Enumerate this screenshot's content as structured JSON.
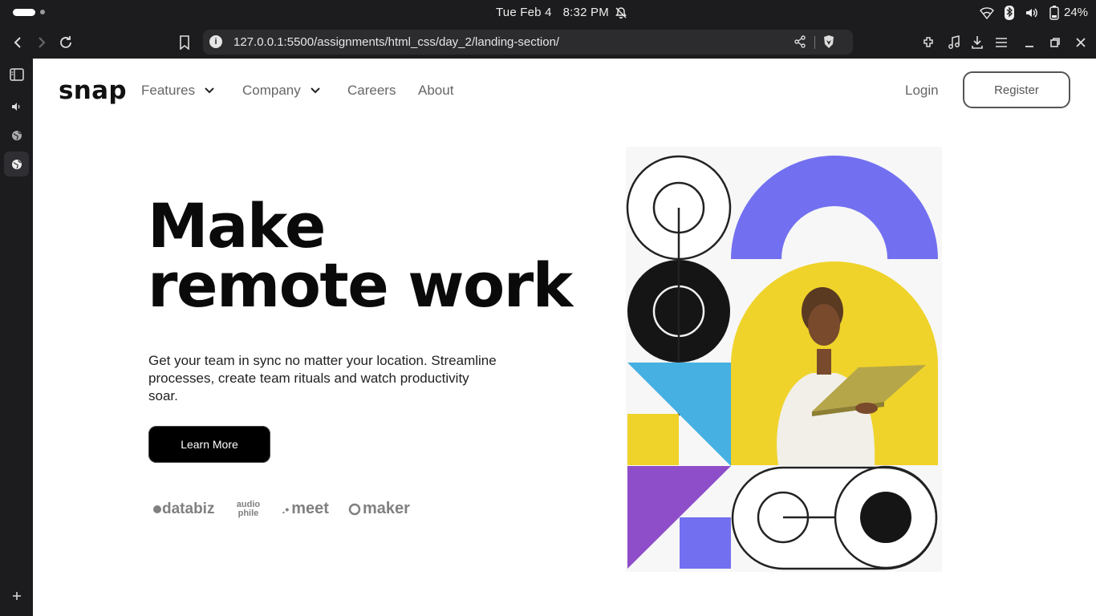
{
  "os": {
    "date": "Tue Feb 4",
    "time": "8:32 PM",
    "battery": "24%"
  },
  "browser": {
    "url": "127.0.0.1:5500/assignments/html_css/day_2/landing-section/"
  },
  "site": {
    "logo": "snap",
    "nav": [
      {
        "label": "Features",
        "has_dropdown": true
      },
      {
        "label": "Company",
        "has_dropdown": true
      },
      {
        "label": "Careers",
        "has_dropdown": false
      },
      {
        "label": "About",
        "has_dropdown": false
      }
    ],
    "login": "Login",
    "register": "Register"
  },
  "hero": {
    "headline_line1": "Make",
    "headline_line2": "remote work",
    "lead": "Get your team in sync no matter your location. Streamline processes, create team rituals and watch productivity soar.",
    "cta": "Learn More",
    "clients": [
      "databiz",
      "audio phile",
      "meet",
      "maker"
    ]
  },
  "colors": {
    "os_bg": "#1c1c1e",
    "brand_text": "#111111",
    "nav_text": "#666666",
    "cta_bg": "#000000",
    "art_purple": "#7270f0",
    "art_yellow": "#efd32a",
    "art_blue": "#46b0e2",
    "art_violet": "#8e4dc9"
  }
}
